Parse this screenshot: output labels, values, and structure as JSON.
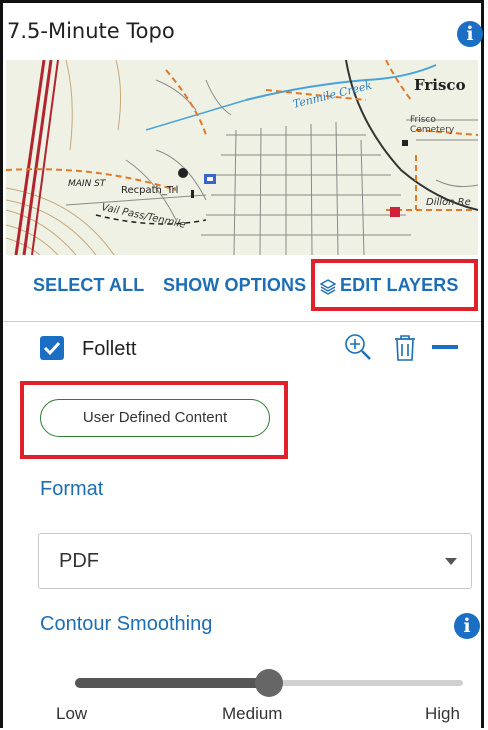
{
  "panel": {
    "title": "7.5-Minute Topo",
    "info_icon": "info-icon"
  },
  "map": {
    "labels": {
      "frisco": "Frisco",
      "tenmile": "Tenmile Creek",
      "cemetery_1": "Frisco",
      "cemetery_2": "Cemetery",
      "main_st": "MAIN ST",
      "recpath": "Recpath_Trl",
      "vailpass": "Vail Pass/Tenmile",
      "dillon": "Dillon Re"
    }
  },
  "toolbar": {
    "select_all": "SELECT ALL",
    "show_options": "SHOW OPTIONS",
    "edit_layers": "EDIT LAYERS",
    "edit_layers_icon": "layers-icon"
  },
  "layer": {
    "name": "Follett",
    "checked": true,
    "icons": [
      "zoom-in-icon",
      "trash-icon",
      "collapse-icon"
    ]
  },
  "chip": {
    "label": "User Defined Content"
  },
  "format": {
    "label": "Format",
    "selected": "PDF"
  },
  "smoothing": {
    "label": "Contour Smoothing",
    "value_fraction": 0.5,
    "ticks": {
      "low": "Low",
      "medium": "Medium",
      "high": "High"
    }
  },
  "colors": {
    "accent": "#1d6eb5",
    "highlight_box": "#e0202a",
    "chip_border": "#2e7d32"
  }
}
